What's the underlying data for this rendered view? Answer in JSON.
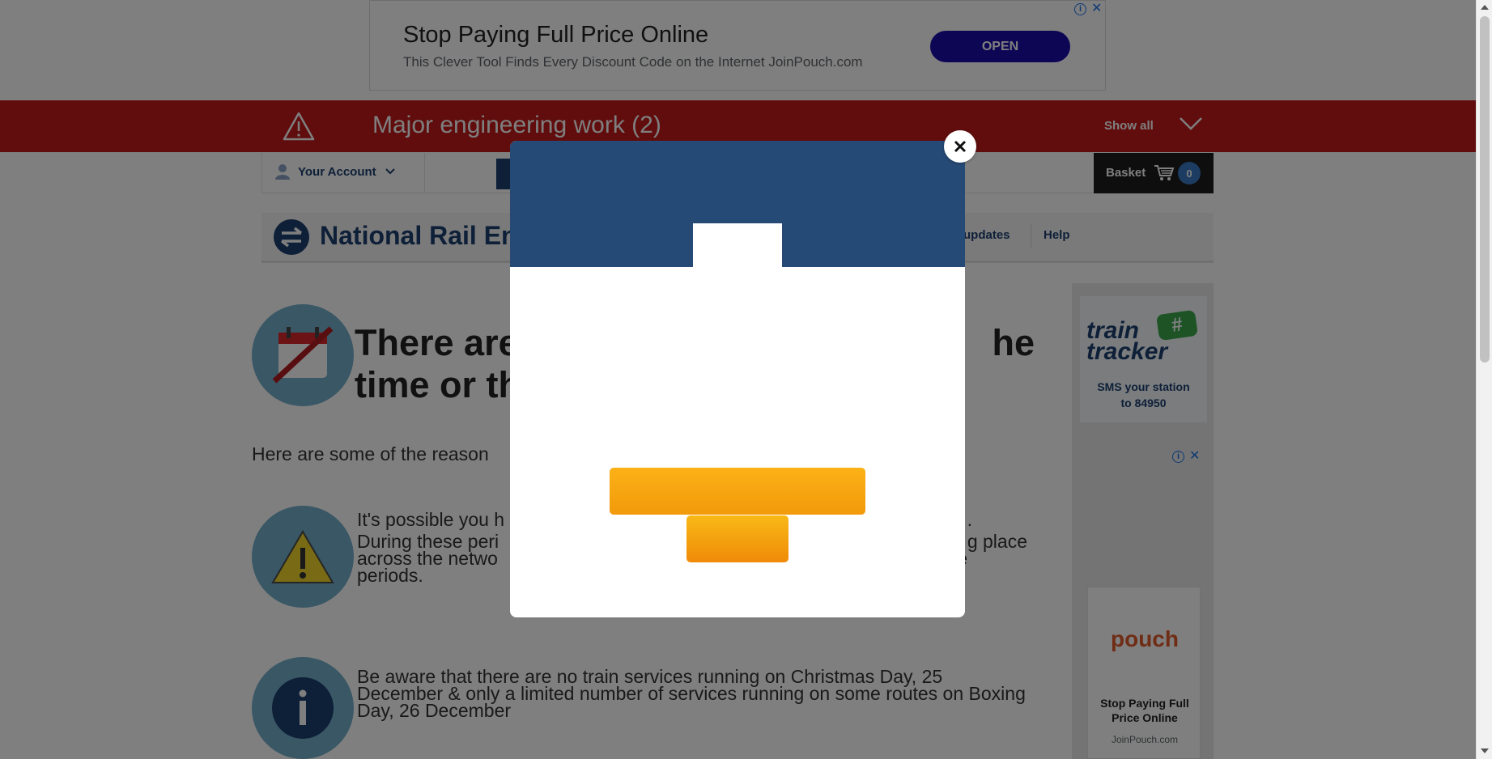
{
  "top_ad": {
    "title": "Stop Paying Full Price Online",
    "subtitle": "This Clever Tool Finds Every Discount Code on the Internet JoinPouch.com",
    "button": "OPEN"
  },
  "alert": {
    "title": "Major engineering work (2)",
    "show_all": "Show all",
    "icon": "warning-triangle-icon"
  },
  "account": {
    "label": "Your Account",
    "icon": "user-icon"
  },
  "basket": {
    "label": "Basket",
    "count": "0",
    "icon": "cart-icon"
  },
  "header": {
    "logo_text": "National Rail Enq",
    "nav": [
      "updates",
      "Help"
    ]
  },
  "main": {
    "heading_line1": "There are",
    "heading_line1_right": "he",
    "heading_line2": "time or th",
    "intro": "Here are some of the reason",
    "reason1_line1": "It's possible you h",
    "reason1_line1_right": ".",
    "reason1_line2": "During these peri",
    "reason1_line2_right": "g place",
    "reason1_line3": "across the netwo",
    "reason1_line3_right": "ese",
    "reason1_line4": "periods.",
    "reason2": "Be aware that there are no train services running on Christmas Day, 25 December & only a limited number of services running on some routes on Boxing Day, 26 December"
  },
  "sidebar": {
    "tt_word1": "train",
    "tt_word2": "tracker",
    "tt_hash": "#",
    "tt_sms1": "SMS your station",
    "tt_sms2": "to 84950",
    "ad_brand": "pouch",
    "ad_title": "Stop Paying Full Price Online",
    "ad_sub": "JoinPouch.com"
  },
  "modal": {
    "close_icon": "close-icon"
  },
  "colors": {
    "alert_red": "#c21a1a",
    "navy": "#1d3f70",
    "modal_header": "#264a76",
    "cta_orange": "#f7a30f"
  }
}
